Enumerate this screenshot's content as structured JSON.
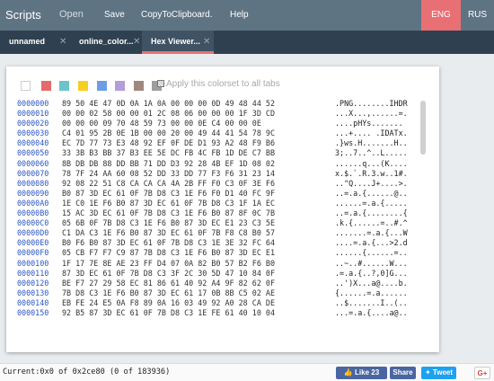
{
  "nav": {
    "brand": "Scripts",
    "open": "Open",
    "save": "Save",
    "copy": "CopyToClipboard.",
    "help": "Help",
    "lang_eng": "ENG",
    "lang_rus": "RUS"
  },
  "tabs": [
    {
      "label": "unnamed",
      "close": "✕"
    },
    {
      "label": "online_color...",
      "close": "✕"
    },
    {
      "label": "Hex Viewer...",
      "close": "✕"
    }
  ],
  "colors": {
    "swatches": [
      "#ffffff",
      "#e56a6a",
      "#6bc5c8",
      "#f5d020",
      "#6b9ee6",
      "#b39ddb",
      "#a1887f",
      "#9e9e9e"
    ]
  },
  "apply_label": "Apply this colorset to all tabs",
  "hex": {
    "rows": [
      {
        "off": "0000000",
        "hex": "89 50 4E 47 0D 0A 1A 0A 00 00 00 0D 49 48 44 52",
        "txt": ".PNG........IHDR"
      },
      {
        "off": "0000010",
        "hex": "00 00 02 58 00 00 01 2C 08 06 00 00 00 1F 3D CD",
        "txt": "...X...,......=."
      },
      {
        "off": "0000020",
        "hex": "00 00 00 09 70 48 59 73 00 00 0E C4 00 00 0E",
        "txt": "....pHYs......."
      },
      {
        "off": "0000030",
        "hex": "C4 01 95 2B 0E 1B 00 00 20 00 49 44 41 54 78 9C",
        "txt": "...+.... .IDATx."
      },
      {
        "off": "0000040",
        "hex": "EC 7D 77 73 E3 48 92 EF 0F DE D1 93 A2 48 F9 B6",
        "txt": ".}ws.H.......H.."
      },
      {
        "off": "0000050",
        "hex": "33 3B B3 BB 37 B3 EE 5E DC FB 4C FB 1D DE C7 BB",
        "txt": "3;..7..^..L....."
      },
      {
        "off": "0000060",
        "hex": "8B DB DB 88 DD BB 71 DD D3 92 28 4B EF 1D 08 02",
        "txt": "......q...(K...."
      },
      {
        "off": "0000070",
        "hex": "78 7F 24 AA 60 08 52 DD 33 DD 77 F3 F6 31 23 14",
        "txt": "x.$.`.R.3.w..1#."
      },
      {
        "off": "0000080",
        "hex": "92 08 22 51 C8 CA CA CA 4A 2B FF F0 C3 0F 3E F6",
        "txt": "..\"Q....J+....>."
      },
      {
        "off": "0000090",
        "hex": "B0 87 3D EC 61 0F 7B D8 C3 1E F6 F0 D1 40 FC 9F",
        "txt": "..=.a.{......@.."
      },
      {
        "off": "00000A0",
        "hex": "1E C0 1E F6 B0 87 3D EC 61 0F 7B D8 C3 1F 1A EC",
        "txt": "......=.a.{....."
      },
      {
        "off": "00000B0",
        "hex": "15 AC 3D EC 61 0F 7B D8 C3 1E F6 B0 87 8F 0C 7B",
        "txt": "..=.a.{........{"
      },
      {
        "off": "00000C0",
        "hex": "05 6B 0F 7B D8 C3 1E F6 B0 87 3D EC E1 23 C3 5E",
        "txt": ".k.{......=..#.^"
      },
      {
        "off": "00000D0",
        "hex": "C1 DA C3 1E F6 B0 87 3D EC 61 0F 7B F8 C8 B0 57",
        "txt": ".......=.a.{...W"
      },
      {
        "off": "00000E0",
        "hex": "B0 F6 B0 87 3D EC 61 0F 7B D8 C3 1E 3E 32 FC 64",
        "txt": "....=.a.{...>2.d"
      },
      {
        "off": "00000F0",
        "hex": "05 CB F7 F7 C9 87 7B D8 C3 1E F6 B0 87 3D EC E1",
        "txt": "......{......=.."
      },
      {
        "off": "0000100",
        "hex": "1F 17 7E 8E AE 23 FF D4 07 0A 82 B0 57 B2 F6 B0",
        "txt": "..~..#......W..."
      },
      {
        "off": "0000110",
        "hex": "87 3D EC 61 0F 7B D8 C3 3F 2C 30 5D 47 10 84 0F",
        "txt": ".=.a.{..?,0]G..."
      },
      {
        "off": "0000120",
        "hex": "BE F7 27 29 58 EC 81 86 61 40 92 A4 9F 82 62 0F",
        "txt": "..')X...a@....b."
      },
      {
        "off": "0000130",
        "hex": "7B D8 C3 1E F6 B0 87 3D EC 61 17 0B 8B C5 02 AE",
        "txt": "{......=.a......"
      },
      {
        "off": "0000140",
        "hex": "EB FE 24 E5 0A F8 89 0A 16 03 49 92 A0 28 CA DE",
        "txt": "..$.......I..(.."
      },
      {
        "off": "0000150",
        "hex": "92 B5 87 3D EC 61 0F 7B D8 C3 1E FE 61 40 10 04",
        "txt": "...=.a.{....a@.."
      }
    ]
  },
  "status": {
    "current": "Current:0x0 of 0x2ce80 (0 of 183936)",
    "like": "Like 23",
    "share": "Share",
    "tweet": "Tweet",
    "gplus": "G+"
  }
}
